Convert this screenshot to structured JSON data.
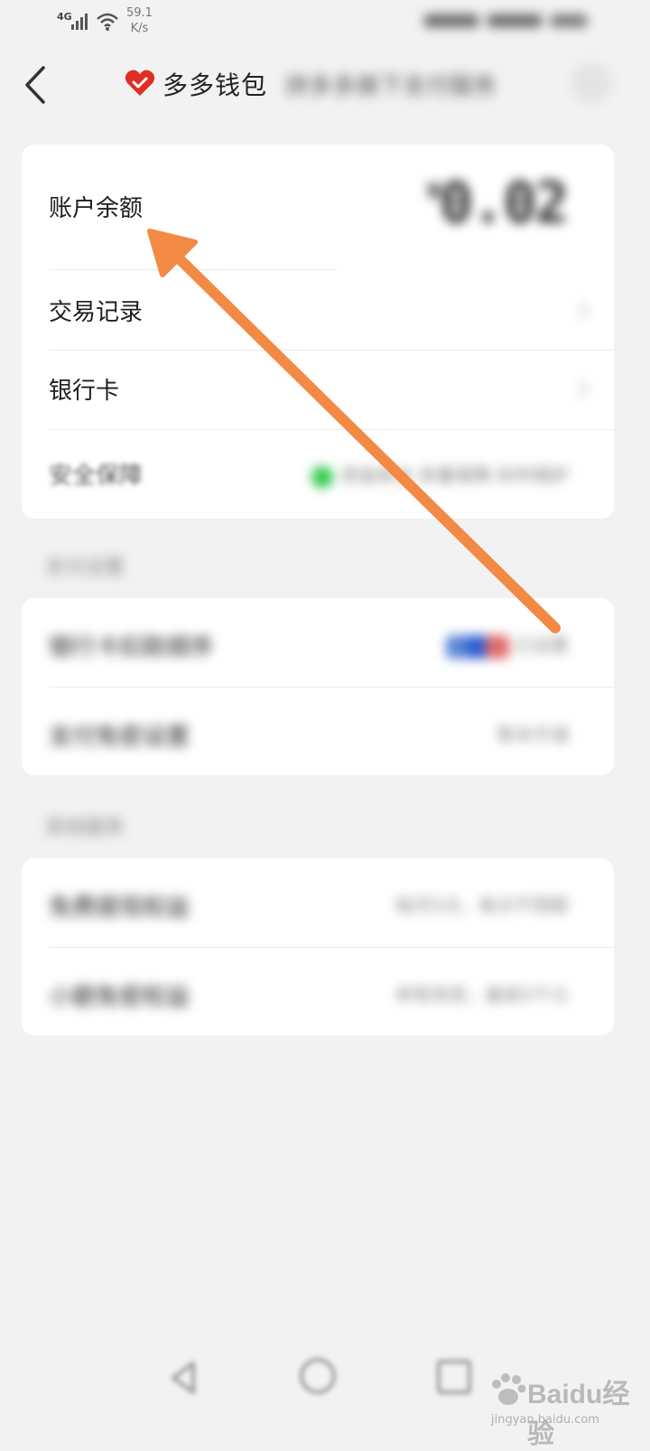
{
  "status_bar": {
    "network": "4G",
    "speed_value": "59.1",
    "speed_unit": "K/s"
  },
  "header": {
    "brand": "多多钱包",
    "subtitle": "拼多多旗下支付服务"
  },
  "wallet_card": {
    "balance_label": "账户余额",
    "balance_currency": "¥",
    "balance_value": "0.02",
    "transactions_label": "交易记录",
    "bank_card_label": "银行卡",
    "security_label": "安全保障",
    "security_status": "资金安全·多重保障·实时保护"
  },
  "payment_section": {
    "title": "支付设置",
    "rows": [
      {
        "label": "银行卡扣款顺序",
        "value": "已设置"
      },
      {
        "label": "支付免密设置",
        "value": "暂未开通"
      }
    ]
  },
  "other_section": {
    "title": "其他服务",
    "rows": [
      {
        "label": "免费提现权益",
        "value": "每月5次，每次不限额"
      },
      {
        "label": "小额免密权益",
        "value": "单笔免密，最高5千元"
      }
    ]
  },
  "watermark": {
    "brand": "Baidu经验",
    "url": "jingyan.baidu.com"
  },
  "colors": {
    "accent_red": "#e02e24",
    "arrow_orange": "#f28a45",
    "security_green": "#2ec84a"
  }
}
